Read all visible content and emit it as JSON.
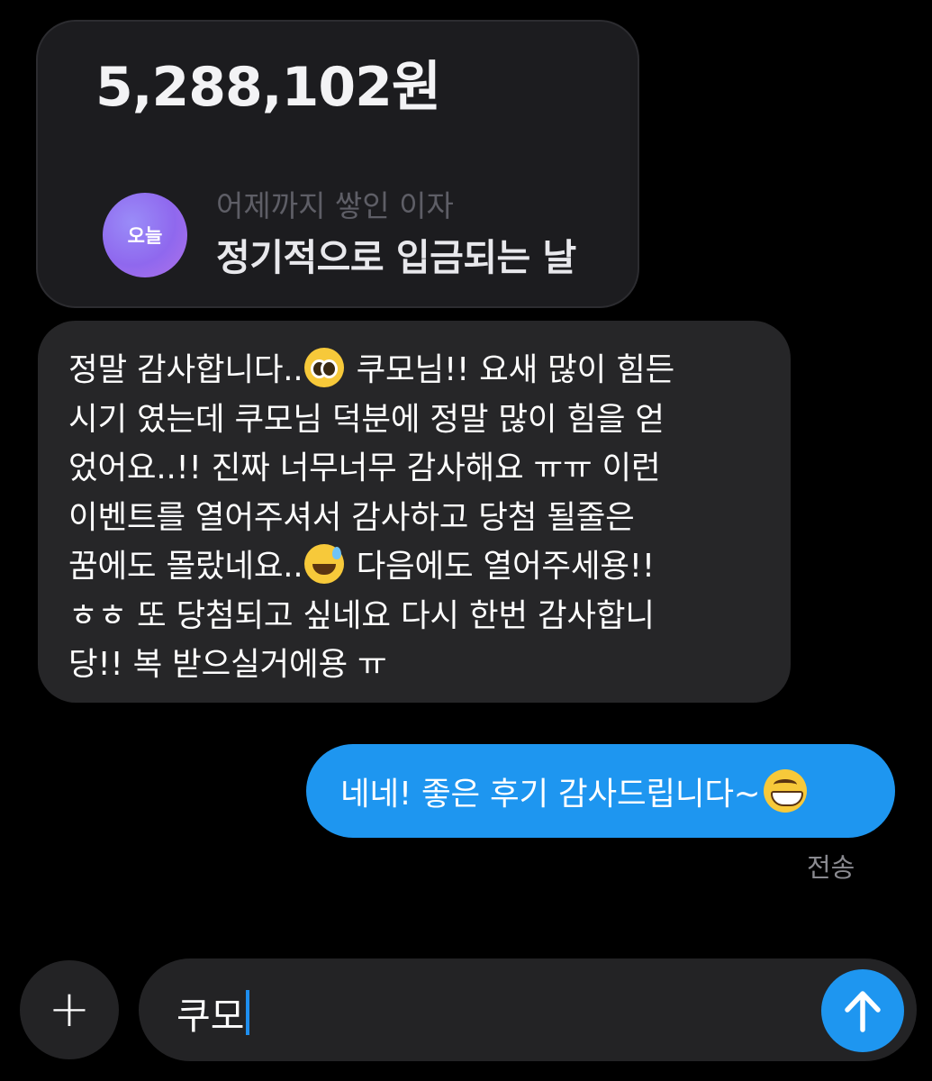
{
  "attachment": {
    "amount": "5,288,102원",
    "avatar_label": "오늘",
    "caption": "어제까지 쌓인 이자",
    "title": "정기적으로 입금되는 날"
  },
  "received_message": {
    "lines": [
      "정말 감사합니다..",
      "쿠모님!! 요새 많이 힘든",
      "시기 였는데 쿠모님 덕분에 정말 많이 힘을 얻",
      "었어요..!! 진짜 너무너무 감사해요 ㅠㅠ 이런",
      "이벤트를 열어주셔서 감사하고 당첨 될줄은",
      "꿈에도 몰랐네요..",
      "다음에도 열어주세용!!",
      "ㅎㅎ 또 당첨되고 싶네요 다시 한번 감사합니",
      "당!! 복 받으실거에용 ㅠ"
    ]
  },
  "sent_message": {
    "text": "네네! 좋은 후기 감사드립니다~"
  },
  "status": "전송",
  "composer": {
    "text": "쿠모"
  },
  "icons": {
    "add": "plus-icon",
    "send": "arrow-up-icon",
    "emoji_1": "pleading-face-emoji",
    "emoji_2": "grinning-sweat-emoji",
    "emoji_3": "grinning-face-emoji"
  },
  "colors": {
    "sent_bubble": "#1e96f0",
    "received_bubble": "#262628",
    "background": "#000000"
  }
}
